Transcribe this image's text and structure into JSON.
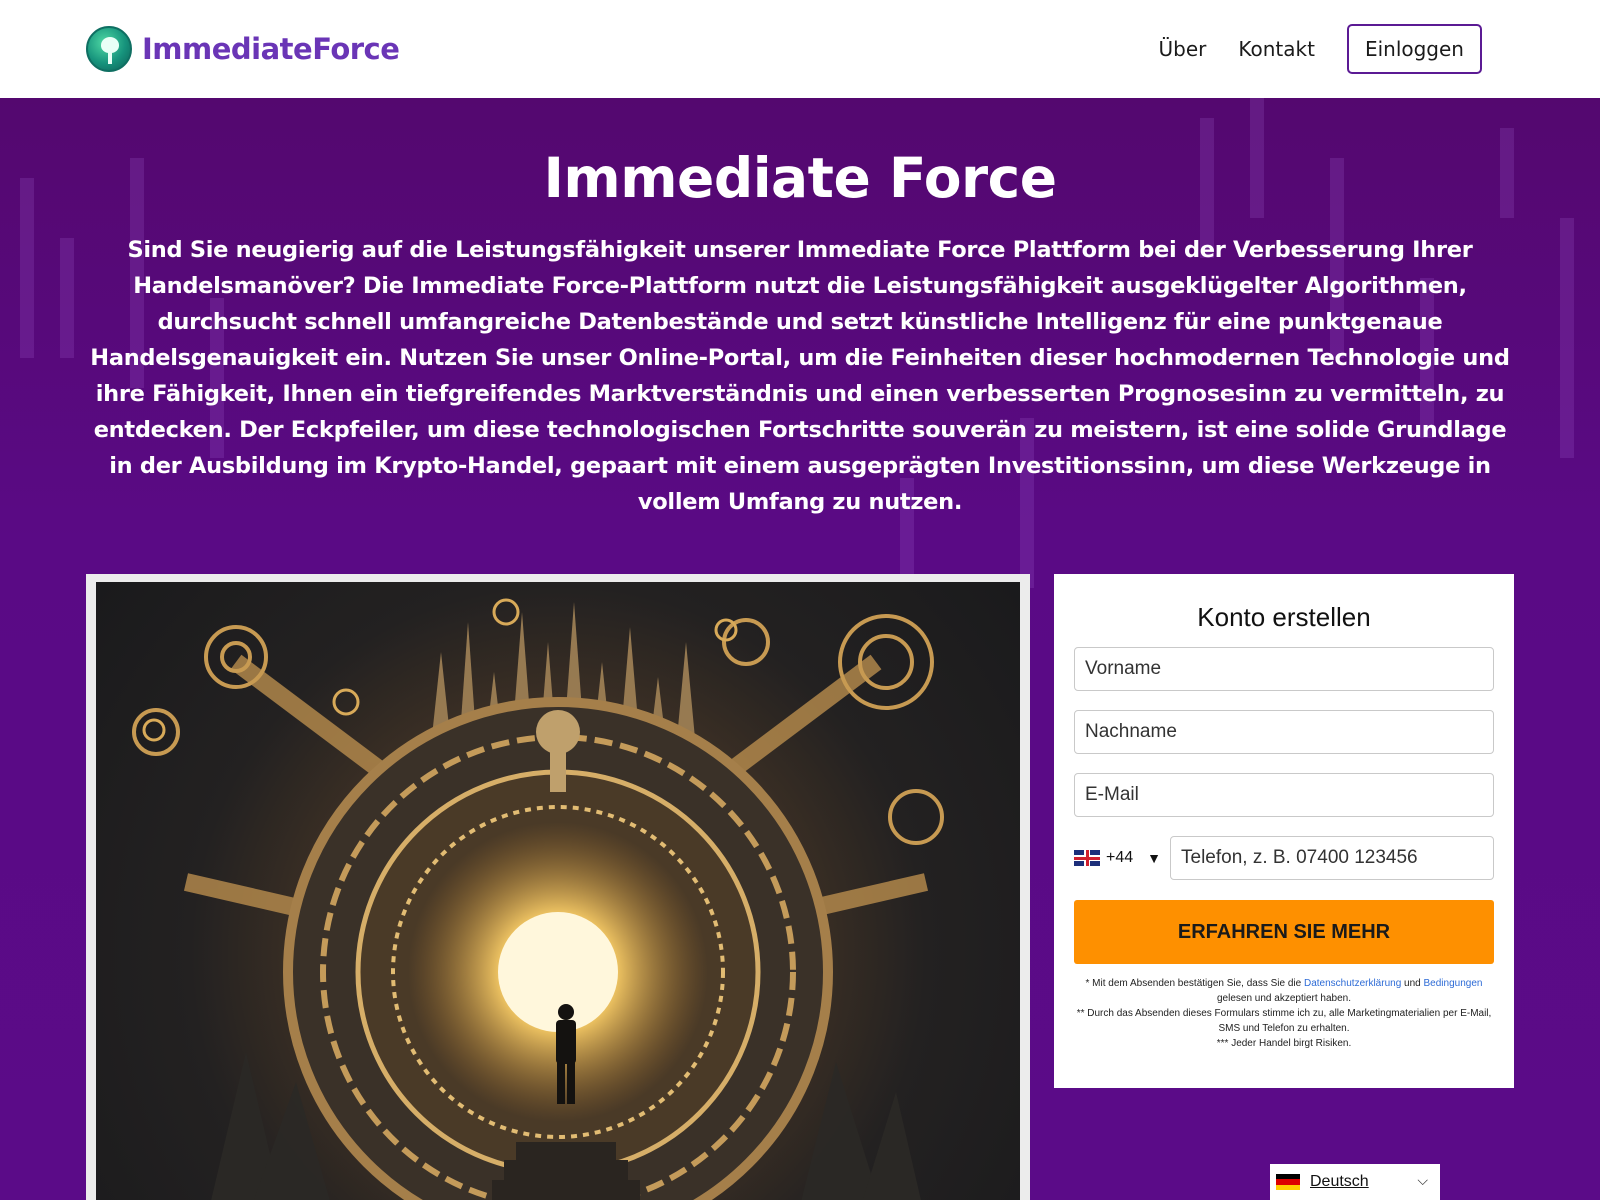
{
  "header": {
    "brand": "ImmediateForce",
    "nav": {
      "about": "Über",
      "contact": "Kontakt",
      "login": "Einloggen"
    }
  },
  "hero": {
    "title": "Immediate Force",
    "description": "Sind Sie neugierig auf die Leistungsfähigkeit unserer Immediate Force Plattform bei der Verbesserung Ihrer Handelsmanöver? Die Immediate Force-Plattform nutzt die Leistungsfähigkeit ausgeklügelter Algorithmen, durchsucht schnell umfangreiche Datenbestände und setzt künstliche Intelligenz für eine punktgenaue Handelsgenauigkeit ein. Nutzen Sie unser Online-Portal, um die Feinheiten dieser hochmodernen Technologie und ihre Fähigkeit, Ihnen ein tiefgreifendes Marktverständnis und einen verbesserten Prognosesinn zu vermitteln, zu entdecken. Der Eckpfeiler, um diese technologischen Fortschritte souverän zu meistern, ist eine solide Grundlage in der Ausbildung im Krypto-Handel, gepaart mit einem ausgeprägten Investitionssinn, um diese Werkzeuge in vollem Umfang zu nutzen."
  },
  "form": {
    "title": "Konto erstellen",
    "first_name_placeholder": "Vorname",
    "last_name_placeholder": "Nachname",
    "email_placeholder": "E-Mail",
    "phone_code": "+44",
    "phone_caret": "▼",
    "phone_placeholder": "Telefon, z. B.  07400 123456",
    "submit_label": "ERFAHREN SIE MEHR",
    "legal": {
      "line1_prefix": "* Mit dem Absenden bestätigen Sie, dass Sie die ",
      "privacy_link": "Datenschutzerklärung",
      "line1_mid": " und ",
      "terms_link": "Bedingungen",
      "line1_suffix": " gelesen und akzeptiert haben.",
      "line2": "** Durch das Absenden dieses Formulars stimme ich zu, alle Marketingmaterialien per E-Mail, SMS und Telefon zu erhalten.",
      "line3": "*** Jeder Handel birgt Risiken."
    }
  },
  "language": {
    "label": "Deutsch",
    "caret": "⌵"
  },
  "colors": {
    "brand_purple": "#6a35b6",
    "hero_bg": "#5a0a86",
    "cta_orange": "#fe9000",
    "link_blue": "#2d6bd6"
  }
}
